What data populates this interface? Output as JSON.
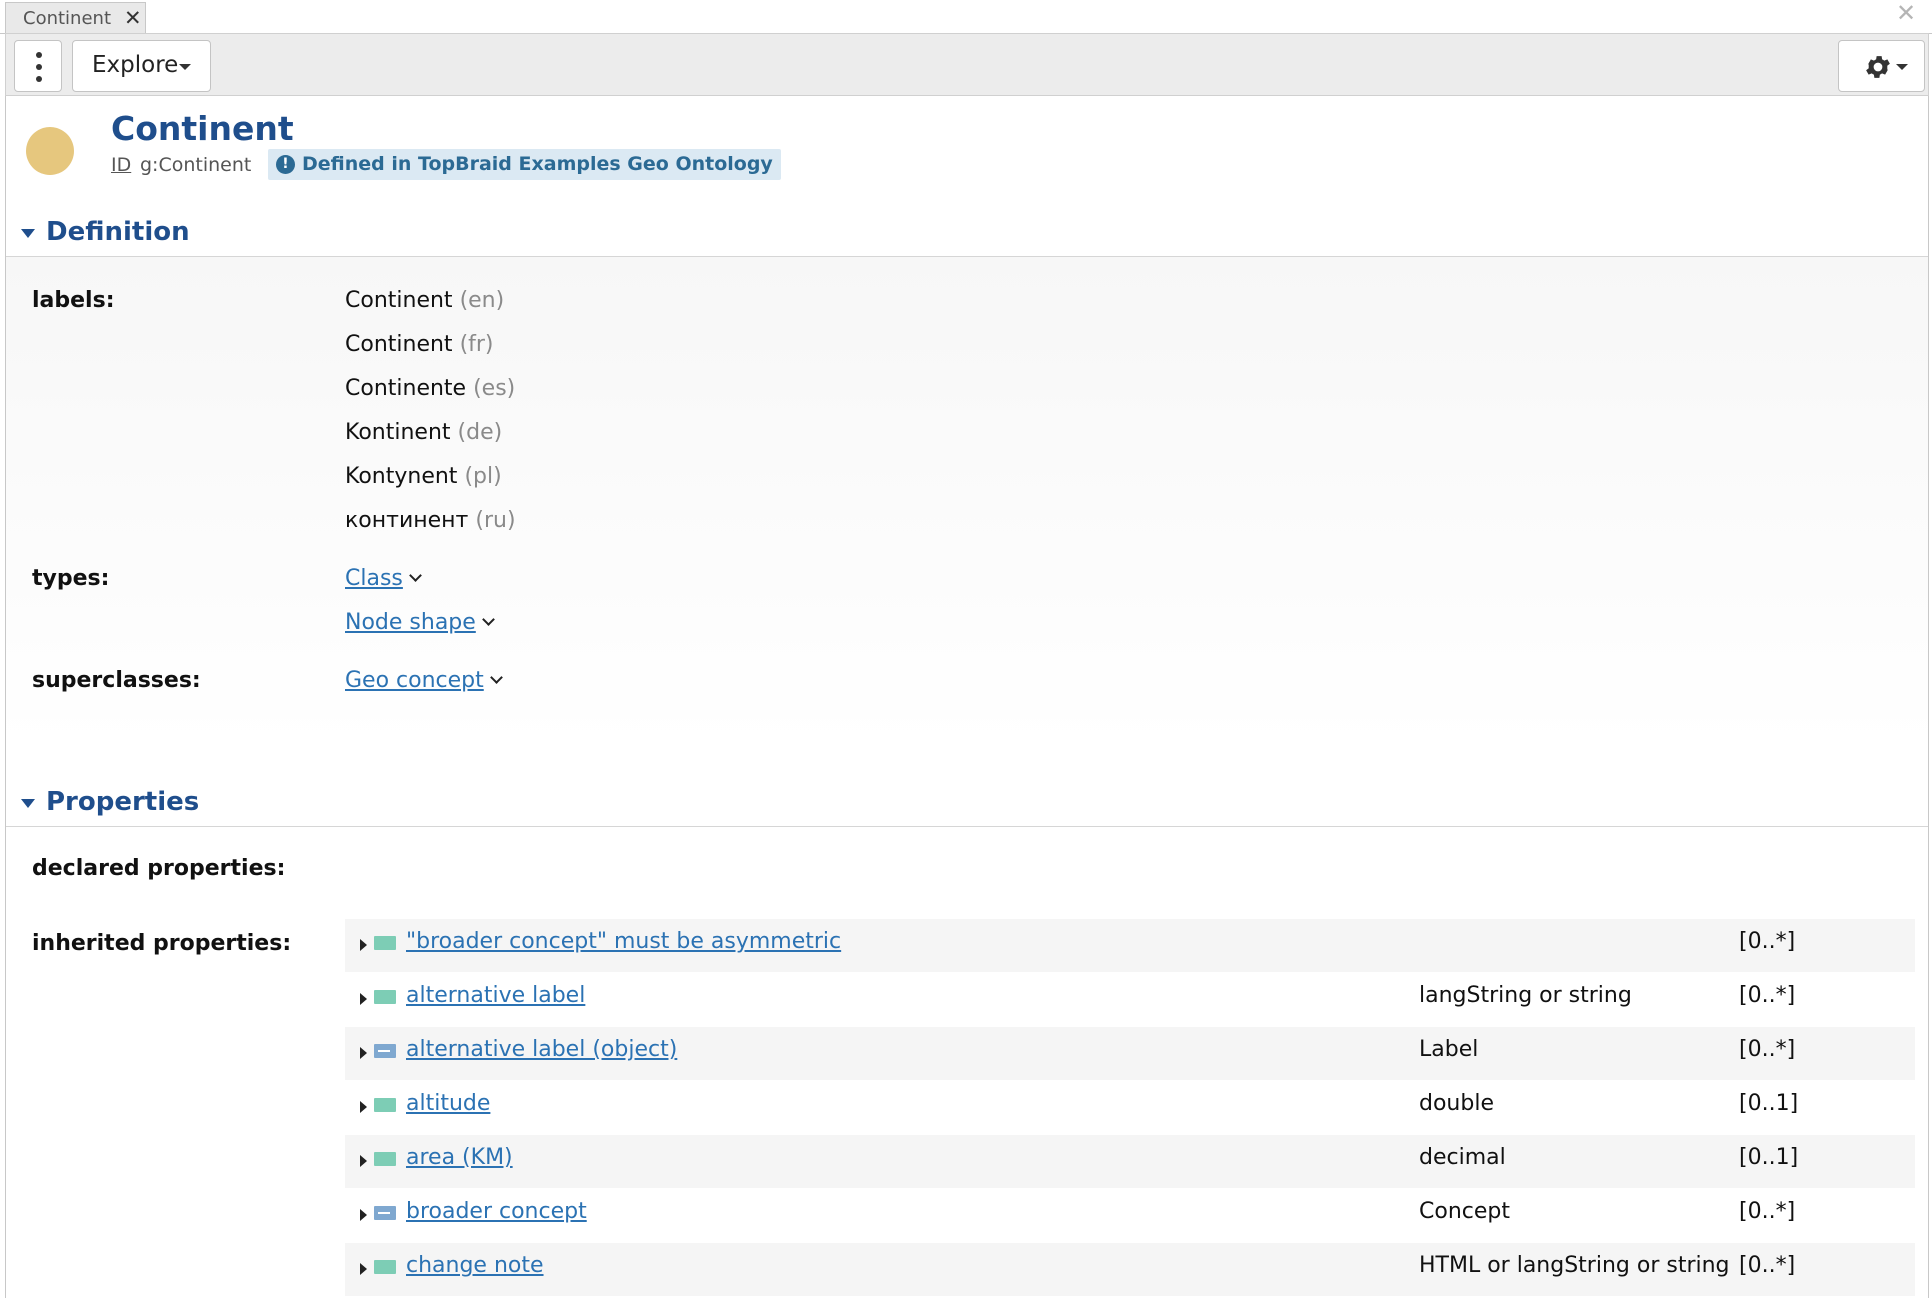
{
  "tab": {
    "label": "Continent",
    "close": "✕"
  },
  "window": {
    "close": "✕"
  },
  "toolbar": {
    "explore_label": "Explore"
  },
  "resource": {
    "title": "Continent",
    "id_label": "ID",
    "id_value": "g:Continent",
    "defined_in": "Defined in TopBraid Examples Geo Ontology",
    "avatar_color": "#e6c77e"
  },
  "definition": {
    "title": "Definition",
    "labels_label": "labels:",
    "labels": [
      {
        "text": "Continent",
        "lang": "(en)"
      },
      {
        "text": "Continent",
        "lang": "(fr)"
      },
      {
        "text": "Continente",
        "lang": "(es)"
      },
      {
        "text": "Kontinent",
        "lang": "(de)"
      },
      {
        "text": "Kontynent",
        "lang": "(pl)"
      },
      {
        "text": "континент",
        "lang": "(ru)"
      }
    ],
    "types_label": "types:",
    "types": [
      "Class",
      "Node shape"
    ],
    "superclasses_label": "superclasses:",
    "superclasses": [
      "Geo concept"
    ]
  },
  "properties": {
    "title": "Properties",
    "declared_label": "declared properties:",
    "inherited_label": "inherited properties:",
    "inherited": [
      {
        "name": "\"broader concept\" must be asymmetric",
        "type": "",
        "card": "[0..*]",
        "icon": "datatype-property-icon"
      },
      {
        "name": "alternative label",
        "type": "langString or string",
        "card": "[0..*]",
        "icon": "datatype-property-icon"
      },
      {
        "name": "alternative label (object)",
        "type": "Label",
        "card": "[0..*]",
        "icon": "object-property-icon"
      },
      {
        "name": "altitude",
        "type": "double",
        "card": "[0..1]",
        "icon": "datatype-property-icon"
      },
      {
        "name": "area (KM)",
        "type": "decimal",
        "card": "[0..1]",
        "icon": "datatype-property-icon"
      },
      {
        "name": "broader concept",
        "type": "Concept",
        "card": "[0..*]",
        "icon": "object-property-icon"
      },
      {
        "name": "change note",
        "type": "HTML or langString or string",
        "card": "[0..*]",
        "icon": "datatype-property-icon"
      }
    ]
  },
  "colors": {
    "accent": "#1f4e8c",
    "link": "#2b72b3",
    "datatype_icon": "#7dcdb5",
    "object_icon": "#7fa8d0"
  }
}
